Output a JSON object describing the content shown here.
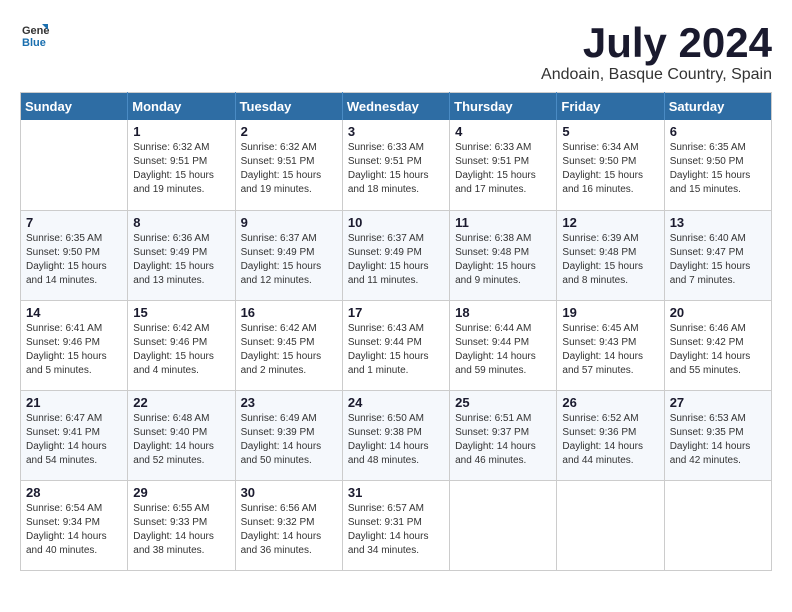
{
  "header": {
    "logo_general": "General",
    "logo_blue": "Blue",
    "month_title": "July 2024",
    "subtitle": "Andoain, Basque Country, Spain"
  },
  "days_of_week": [
    "Sunday",
    "Monday",
    "Tuesday",
    "Wednesday",
    "Thursday",
    "Friday",
    "Saturday"
  ],
  "weeks": [
    [
      {
        "day": "",
        "info": ""
      },
      {
        "day": "1",
        "info": "Sunrise: 6:32 AM\nSunset: 9:51 PM\nDaylight: 15 hours\nand 19 minutes."
      },
      {
        "day": "2",
        "info": "Sunrise: 6:32 AM\nSunset: 9:51 PM\nDaylight: 15 hours\nand 19 minutes."
      },
      {
        "day": "3",
        "info": "Sunrise: 6:33 AM\nSunset: 9:51 PM\nDaylight: 15 hours\nand 18 minutes."
      },
      {
        "day": "4",
        "info": "Sunrise: 6:33 AM\nSunset: 9:51 PM\nDaylight: 15 hours\nand 17 minutes."
      },
      {
        "day": "5",
        "info": "Sunrise: 6:34 AM\nSunset: 9:50 PM\nDaylight: 15 hours\nand 16 minutes."
      },
      {
        "day": "6",
        "info": "Sunrise: 6:35 AM\nSunset: 9:50 PM\nDaylight: 15 hours\nand 15 minutes."
      }
    ],
    [
      {
        "day": "7",
        "info": "Sunrise: 6:35 AM\nSunset: 9:50 PM\nDaylight: 15 hours\nand 14 minutes."
      },
      {
        "day": "8",
        "info": "Sunrise: 6:36 AM\nSunset: 9:49 PM\nDaylight: 15 hours\nand 13 minutes."
      },
      {
        "day": "9",
        "info": "Sunrise: 6:37 AM\nSunset: 9:49 PM\nDaylight: 15 hours\nand 12 minutes."
      },
      {
        "day": "10",
        "info": "Sunrise: 6:37 AM\nSunset: 9:49 PM\nDaylight: 15 hours\nand 11 minutes."
      },
      {
        "day": "11",
        "info": "Sunrise: 6:38 AM\nSunset: 9:48 PM\nDaylight: 15 hours\nand 9 minutes."
      },
      {
        "day": "12",
        "info": "Sunrise: 6:39 AM\nSunset: 9:48 PM\nDaylight: 15 hours\nand 8 minutes."
      },
      {
        "day": "13",
        "info": "Sunrise: 6:40 AM\nSunset: 9:47 PM\nDaylight: 15 hours\nand 7 minutes."
      }
    ],
    [
      {
        "day": "14",
        "info": "Sunrise: 6:41 AM\nSunset: 9:46 PM\nDaylight: 15 hours\nand 5 minutes."
      },
      {
        "day": "15",
        "info": "Sunrise: 6:42 AM\nSunset: 9:46 PM\nDaylight: 15 hours\nand 4 minutes."
      },
      {
        "day": "16",
        "info": "Sunrise: 6:42 AM\nSunset: 9:45 PM\nDaylight: 15 hours\nand 2 minutes."
      },
      {
        "day": "17",
        "info": "Sunrise: 6:43 AM\nSunset: 9:44 PM\nDaylight: 15 hours\nand 1 minute."
      },
      {
        "day": "18",
        "info": "Sunrise: 6:44 AM\nSunset: 9:44 PM\nDaylight: 14 hours\nand 59 minutes."
      },
      {
        "day": "19",
        "info": "Sunrise: 6:45 AM\nSunset: 9:43 PM\nDaylight: 14 hours\nand 57 minutes."
      },
      {
        "day": "20",
        "info": "Sunrise: 6:46 AM\nSunset: 9:42 PM\nDaylight: 14 hours\nand 55 minutes."
      }
    ],
    [
      {
        "day": "21",
        "info": "Sunrise: 6:47 AM\nSunset: 9:41 PM\nDaylight: 14 hours\nand 54 minutes."
      },
      {
        "day": "22",
        "info": "Sunrise: 6:48 AM\nSunset: 9:40 PM\nDaylight: 14 hours\nand 52 minutes."
      },
      {
        "day": "23",
        "info": "Sunrise: 6:49 AM\nSunset: 9:39 PM\nDaylight: 14 hours\nand 50 minutes."
      },
      {
        "day": "24",
        "info": "Sunrise: 6:50 AM\nSunset: 9:38 PM\nDaylight: 14 hours\nand 48 minutes."
      },
      {
        "day": "25",
        "info": "Sunrise: 6:51 AM\nSunset: 9:37 PM\nDaylight: 14 hours\nand 46 minutes."
      },
      {
        "day": "26",
        "info": "Sunrise: 6:52 AM\nSunset: 9:36 PM\nDaylight: 14 hours\nand 44 minutes."
      },
      {
        "day": "27",
        "info": "Sunrise: 6:53 AM\nSunset: 9:35 PM\nDaylight: 14 hours\nand 42 minutes."
      }
    ],
    [
      {
        "day": "28",
        "info": "Sunrise: 6:54 AM\nSunset: 9:34 PM\nDaylight: 14 hours\nand 40 minutes."
      },
      {
        "day": "29",
        "info": "Sunrise: 6:55 AM\nSunset: 9:33 PM\nDaylight: 14 hours\nand 38 minutes."
      },
      {
        "day": "30",
        "info": "Sunrise: 6:56 AM\nSunset: 9:32 PM\nDaylight: 14 hours\nand 36 minutes."
      },
      {
        "day": "31",
        "info": "Sunrise: 6:57 AM\nSunset: 9:31 PM\nDaylight: 14 hours\nand 34 minutes."
      },
      {
        "day": "",
        "info": ""
      },
      {
        "day": "",
        "info": ""
      },
      {
        "day": "",
        "info": ""
      }
    ]
  ]
}
